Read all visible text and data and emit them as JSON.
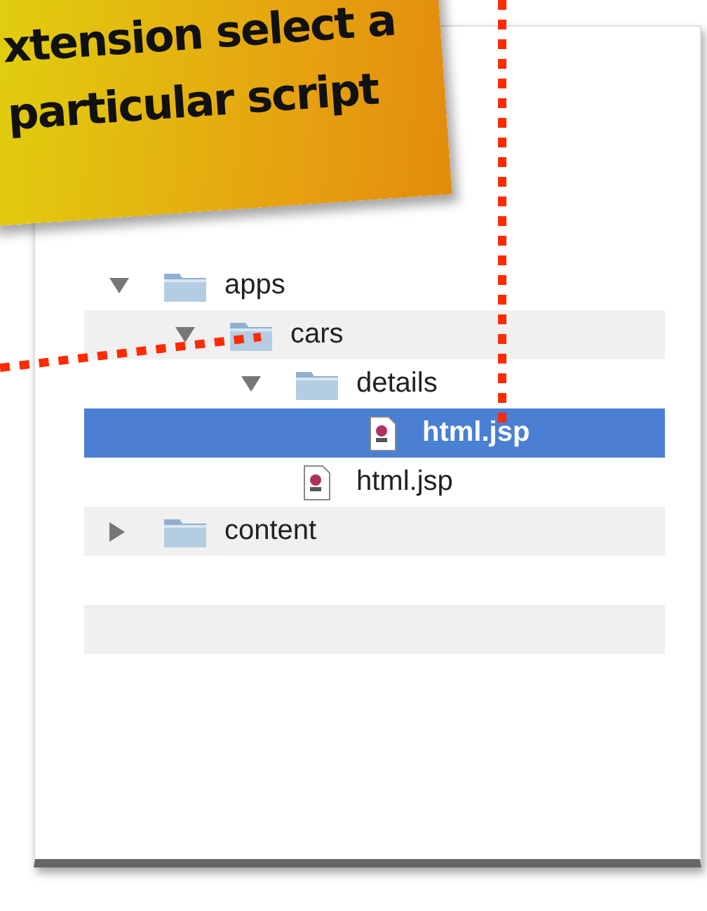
{
  "callout": {
    "lines": [
      "xtension select a",
      "particular script"
    ]
  },
  "tree": [
    {
      "kind": "folder",
      "label": "apps",
      "expanded": true,
      "selected": false,
      "children": [
        {
          "kind": "folder",
          "label": "cars",
          "expanded": true,
          "selected": false,
          "children": [
            {
              "kind": "folder",
              "label": "details",
              "expanded": true,
              "selected": false,
              "children": [
                {
                  "kind": "file",
                  "label": "html.jsp",
                  "selected": true
                }
              ]
            },
            {
              "kind": "file",
              "label": "html.jsp",
              "selected": false
            }
          ]
        }
      ]
    },
    {
      "kind": "folder",
      "label": "content",
      "expanded": false,
      "selected": false
    }
  ]
}
